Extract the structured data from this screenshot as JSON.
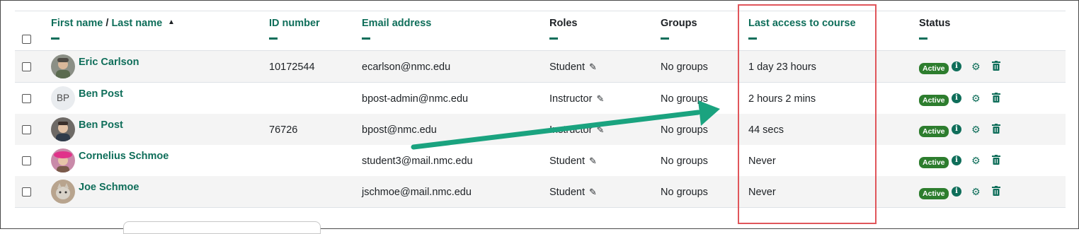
{
  "table": {
    "headers": {
      "first_name": "First name",
      "slash": "/",
      "last_name": "Last name",
      "id_number": "ID number",
      "email": "Email address",
      "roles": "Roles",
      "groups": "Groups",
      "last_access": "Last access to course",
      "status": "Status"
    },
    "rows": [
      {
        "name": "Eric Carlson",
        "id": "10172544",
        "email": "ecarlson@nmc.edu",
        "role": "Student",
        "groups": "No groups",
        "last_access": "1 day 23 hours",
        "status": "Active",
        "avatar": "photo"
      },
      {
        "name": "Ben Post",
        "id": "",
        "email": "bpost-admin@nmc.edu",
        "role": "Instructor",
        "groups": "No groups",
        "last_access": "2 hours 2 mins",
        "status": "Active",
        "avatar": "BP"
      },
      {
        "name": "Ben Post",
        "id": "76726",
        "email": "bpost@nmc.edu",
        "role": "Instructor",
        "groups": "No groups",
        "last_access": "44 secs",
        "status": "Active",
        "avatar": "photo"
      },
      {
        "name": "Cornelius Schmoe",
        "id": "",
        "email": "student3@mail.nmc.edu",
        "role": "Student",
        "groups": "No groups",
        "last_access": "Never",
        "status": "Active",
        "avatar": "photo"
      },
      {
        "name": "Joe Schmoe",
        "id": "",
        "email": "jschmoe@mail.nmc.edu",
        "role": "Student",
        "groups": "No groups",
        "last_access": "Never",
        "status": "Active",
        "avatar": "photo"
      }
    ]
  },
  "colors": {
    "link": "#0f6e5a",
    "badge": "#2d7d2e",
    "highlight_box": "#e0565b",
    "arrow": "#1aa37f"
  },
  "icons": [
    "sort-up-icon",
    "pencil-icon",
    "info-icon",
    "gear-icon",
    "trash-icon"
  ]
}
